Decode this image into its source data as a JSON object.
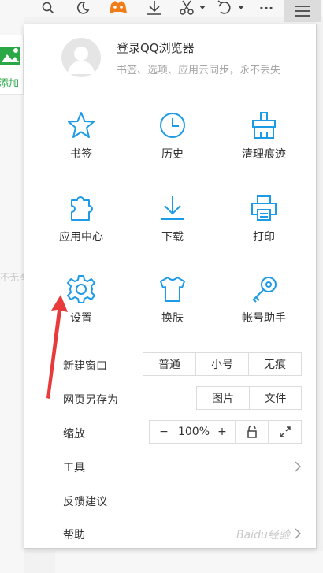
{
  "toolbar": {
    "icons": [
      "search-icon",
      "moon-icon",
      "game-icon",
      "download-icon",
      "scissors-icon",
      "chevron-down-icon",
      "undo-icon",
      "chevron-down-icon",
      "more-icon",
      "menu-icon"
    ],
    "more_label": "···"
  },
  "background": {
    "tile_label": "添加",
    "side_text": "不无图"
  },
  "menu": {
    "user": {
      "login_label": "登录QQ浏览器",
      "subtitle": "书签、选项、应用云同步，永不丢失"
    },
    "grid": [
      {
        "label": "书签",
        "icon": "star-icon"
      },
      {
        "label": "历史",
        "icon": "clock-icon"
      },
      {
        "label": "清理痕迹",
        "icon": "broom-icon"
      },
      {
        "label": "应用中心",
        "icon": "puzzle-icon"
      },
      {
        "label": "下载",
        "icon": "download-icon"
      },
      {
        "label": "打印",
        "icon": "printer-icon"
      },
      {
        "label": "设置",
        "icon": "gear-icon"
      },
      {
        "label": "换肤",
        "icon": "shirt-icon"
      },
      {
        "label": "帐号助手",
        "icon": "key-icon"
      }
    ],
    "new_window": {
      "label": "新建窗口",
      "options": [
        "普通",
        "小号",
        "无痕"
      ]
    },
    "save_page": {
      "label": "网页另存为",
      "options": [
        "图片",
        "文件"
      ]
    },
    "zoom": {
      "label": "缩放",
      "minus": "−",
      "value": "100%",
      "plus": "+",
      "lock_icon": "lock-icon",
      "fullscreen_icon": "fullscreen-icon"
    },
    "tools": {
      "label": "工具"
    },
    "feedback": {
      "label": "反馈建议"
    },
    "help": {
      "label": "帮助"
    }
  },
  "annotation": {
    "arrow": "red-arrow",
    "points_to": "设置"
  },
  "watermark": "Baidu经验",
  "colors": {
    "accent": "#1e9be6",
    "arrow": "#e83a3a",
    "game": "#f07d1a",
    "tile_green": "#2aa846"
  }
}
